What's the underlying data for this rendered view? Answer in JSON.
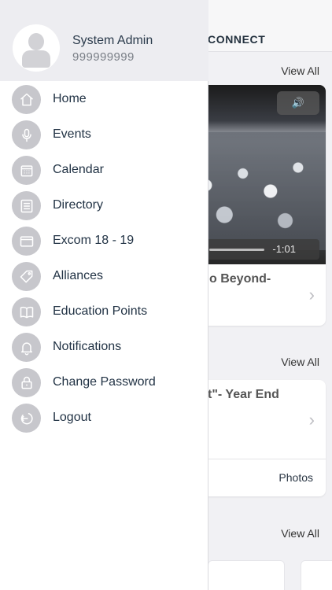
{
  "background": {
    "header_title": "CONNECT",
    "view_all_label": "View All",
    "video": {
      "time": "-1:01",
      "card_title_fragment": "o Beyond-"
    },
    "event_card": {
      "title_fragment": "t\"- Year End",
      "photos_label": "Photos"
    }
  },
  "profile": {
    "name": "System Admin",
    "phone": "999999999"
  },
  "menu": [
    {
      "label": "Home",
      "icon": "home-icon"
    },
    {
      "label": "Events",
      "icon": "microphone-icon"
    },
    {
      "label": "Calendar",
      "icon": "calendar-icon"
    },
    {
      "label": "Directory",
      "icon": "list-icon"
    },
    {
      "label": "Excom 18 - 19",
      "icon": "window-icon"
    },
    {
      "label": "Alliances",
      "icon": "tag-icon"
    },
    {
      "label": "Education Points",
      "icon": "book-icon"
    },
    {
      "label": "Notifications",
      "icon": "bell-icon"
    },
    {
      "label": "Change Password",
      "icon": "lock-icon"
    },
    {
      "label": "Logout",
      "icon": "logout-icon"
    }
  ],
  "colors": {
    "drawer_bg": "#ffffff",
    "profile_bg": "#ededf1",
    "icon_circle": "#c7c7cc",
    "menu_text": "#223345"
  }
}
